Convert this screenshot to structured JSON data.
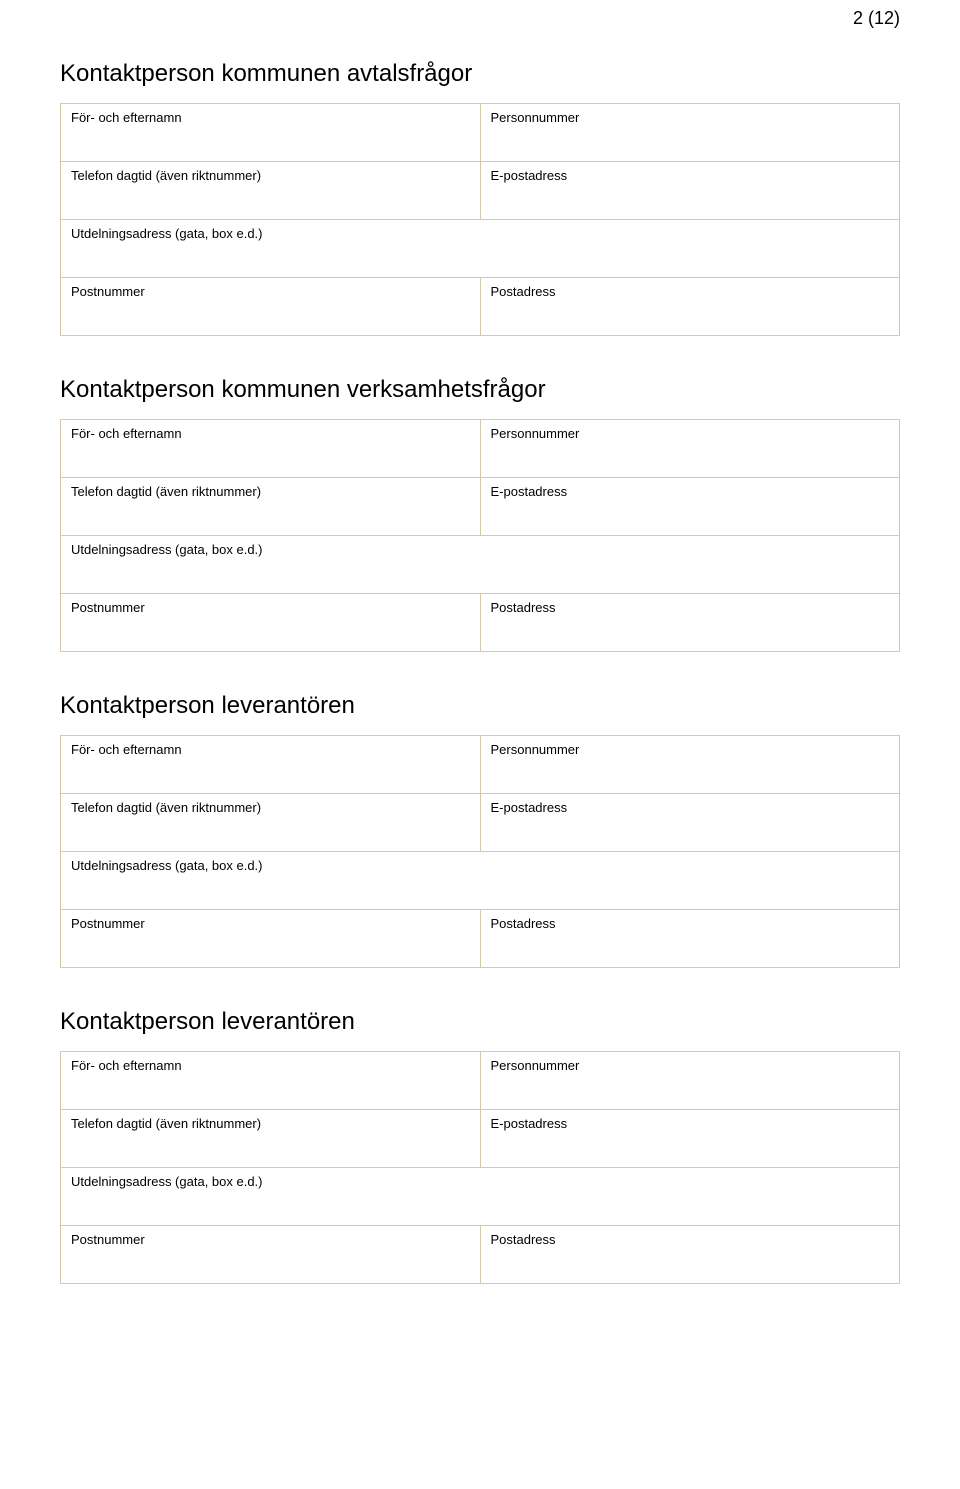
{
  "page_number": "2 (12)",
  "sections": [
    {
      "title": "Kontaktperson kommunen avtalsfrågor",
      "rows": [
        {
          "left": "För- och efternamn",
          "right": "Personnummer"
        },
        {
          "left": "Telefon dagtid (även riktnummer)",
          "right": "E-postadress"
        },
        {
          "full": "Utdelningsadress (gata, box e.d.)"
        },
        {
          "left": "Postnummer",
          "right": "Postadress"
        }
      ]
    },
    {
      "title": "Kontaktperson kommunen verksamhetsfrågor",
      "rows": [
        {
          "left": "För- och efternamn",
          "right": "Personnummer"
        },
        {
          "left": "Telefon dagtid (även riktnummer)",
          "right": "E-postadress"
        },
        {
          "full": "Utdelningsadress (gata, box e.d.)"
        },
        {
          "left": "Postnummer",
          "right": "Postadress"
        }
      ]
    },
    {
      "title": "Kontaktperson leverantören",
      "rows": [
        {
          "left": "För- och efternamn",
          "right": "Personnummer"
        },
        {
          "left": "Telefon dagtid (även riktnummer)",
          "right": "E-postadress"
        },
        {
          "full": "Utdelningsadress (gata, box e.d.)"
        },
        {
          "left": "Postnummer",
          "right": "Postadress"
        }
      ]
    },
    {
      "title": "Kontaktperson leverantören",
      "rows": [
        {
          "left": "För- och efternamn",
          "right": "Personnummer"
        },
        {
          "left": "Telefon dagtid (även riktnummer)",
          "right": "E-postadress"
        },
        {
          "full": "Utdelningsadress (gata, box e.d.)"
        },
        {
          "left": "Postnummer",
          "right": "Postadress"
        }
      ]
    }
  ]
}
